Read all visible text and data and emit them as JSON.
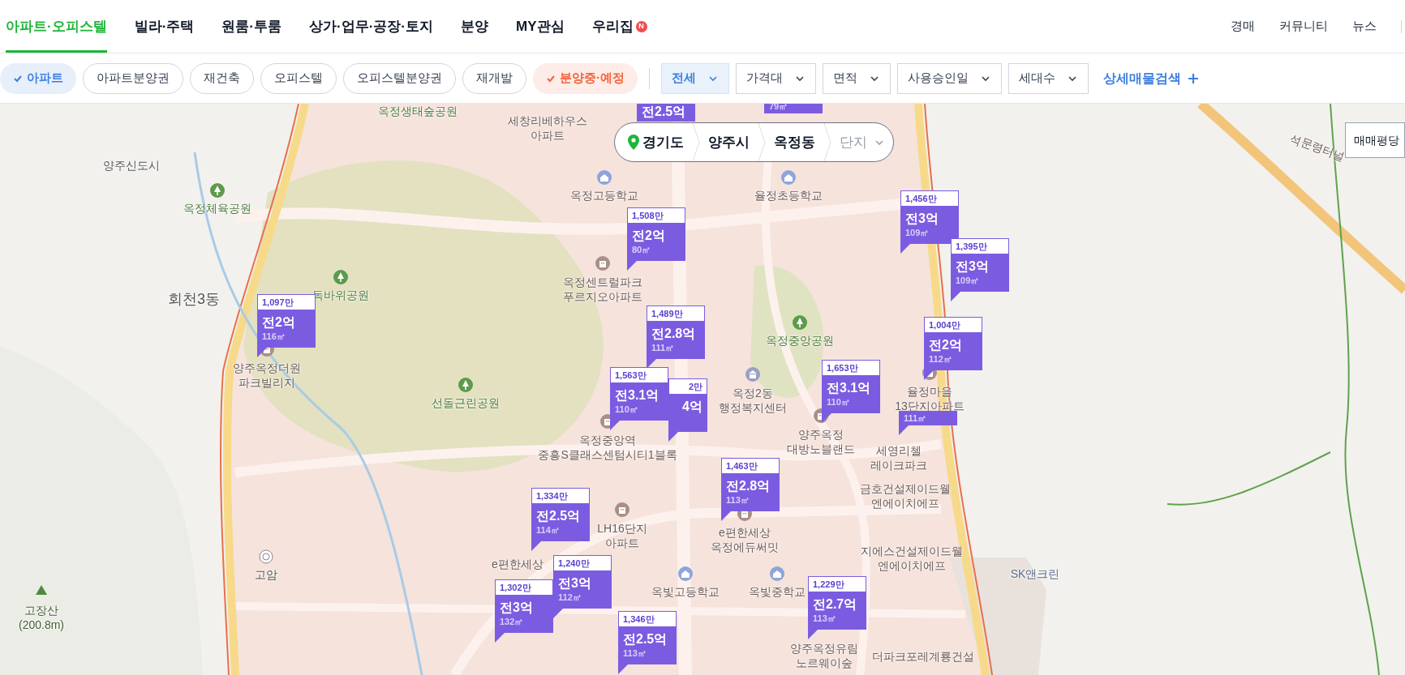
{
  "nav": {
    "tabs": [
      {
        "label": "아파트·오피스텔",
        "selected": true
      },
      {
        "label": "빌라·주택",
        "selected": false
      },
      {
        "label": "원룸·투룸",
        "selected": false
      },
      {
        "label": "상가·업무·공장·토지",
        "selected": false
      },
      {
        "label": "분양",
        "selected": false
      },
      {
        "label": "MY관심",
        "selected": false
      },
      {
        "label": "우리집",
        "selected": false,
        "badge": "N"
      }
    ],
    "links": [
      "경매",
      "커뮤니티",
      "뉴스"
    ]
  },
  "filters": {
    "chips": [
      {
        "label": "아파트",
        "selected": true,
        "color": "#3d7fe0"
      },
      {
        "label": "아파트분양권",
        "selected": false
      },
      {
        "label": "재건축",
        "selected": false
      },
      {
        "label": "오피스텔",
        "selected": false
      },
      {
        "label": "오피스텔분양권",
        "selected": false
      },
      {
        "label": "재개발",
        "selected": false
      },
      {
        "label": "분양중·예정",
        "selected": true,
        "color": "#f0643c"
      }
    ],
    "dropdowns": [
      {
        "label": "전세",
        "selected": true
      },
      {
        "label": "가격대",
        "selected": false
      },
      {
        "label": "면적",
        "selected": false
      },
      {
        "label": "사용승인일",
        "selected": false
      },
      {
        "label": "세대수",
        "selected": false
      }
    ],
    "detail_search": "상세매물검색"
  },
  "breadcrumb": {
    "items": [
      "경기도",
      "양주시",
      "옥정동"
    ],
    "select": "단지"
  },
  "map": {
    "labels": [
      {
        "text": "옥정생태숲공원",
        "kind": "park"
      },
      {
        "text": "세창리베하우스\n아파트",
        "kind": "apartment"
      },
      {
        "text": "양주신도시",
        "kind": "area"
      },
      {
        "text": "옥정체육공원",
        "kind": "park"
      },
      {
        "text": "회천3동",
        "kind": "district"
      },
      {
        "text": "독바위공원",
        "kind": "park"
      },
      {
        "text": "양주옥정더원\n파크빌리지",
        "kind": "apartment"
      },
      {
        "text": "선돌근린공원",
        "kind": "park"
      },
      {
        "text": "옥정고등학교",
        "kind": "school"
      },
      {
        "text": "율정초등학교",
        "kind": "school"
      },
      {
        "text": "옥정센트럴파크\n푸르지오아파트",
        "kind": "apartment"
      },
      {
        "text": "옥정중앙공원",
        "kind": "park"
      },
      {
        "text": "옥정2동\n행정복지센터",
        "kind": "office"
      },
      {
        "text": "양주옥정\n대방노블랜드",
        "kind": "apartment"
      },
      {
        "text": "율정마을\n13단지아파트",
        "kind": "apartment"
      },
      {
        "text": "세영리첼\n레이크파크",
        "kind": "apartment"
      },
      {
        "text": "옥정중앙역\n중흥S클래스센텀시티1블록",
        "kind": "apartment"
      },
      {
        "text": "LH16단지\n아파트",
        "kind": "apartment"
      },
      {
        "text": "e편한세상\n옥정에듀써밋",
        "kind": "apartment"
      },
      {
        "text": "금호건설제이드웰\n엔에이치에프",
        "kind": "apartment"
      },
      {
        "text": "지에스건설제이드웰\n엔에이치에프",
        "kind": "apartment"
      },
      {
        "text": "옥빛고등학교",
        "kind": "school"
      },
      {
        "text": "옥빛중학교",
        "kind": "school"
      },
      {
        "text": "양주옥정유림\n노르웨이숲",
        "kind": "apartment"
      },
      {
        "text": "더파크포레계룡건설",
        "kind": "apartment"
      },
      {
        "text": "SK앤크린",
        "kind": "shop"
      },
      {
        "text": "고암",
        "kind": "interchange"
      },
      {
        "text": "고장산\n(200.8m)",
        "kind": "mountain"
      },
      {
        "text": "e편한세상",
        "kind": "apartment"
      },
      {
        "text": "석문령터널",
        "kind": "tunnel"
      }
    ],
    "markers": [
      {
        "kind": "clipped",
        "label": "전2.5억"
      },
      {
        "kind": "clipped",
        "area": "79㎡"
      },
      {
        "kind": "full",
        "price": "1,097만",
        "label": "전2억",
        "area": "116㎡"
      },
      {
        "kind": "full",
        "price": "1,508만",
        "label": "전2억",
        "area": "80㎡"
      },
      {
        "kind": "full",
        "price": "1,456만",
        "label": "전3억",
        "area": "109㎡"
      },
      {
        "kind": "full",
        "price": "1,395만",
        "label": "전3억",
        "area": "109㎡"
      },
      {
        "kind": "full",
        "price": "1,489만",
        "label": "전2.8억",
        "area": "111㎡"
      },
      {
        "kind": "full",
        "price": "1,004만",
        "label": "전2억",
        "area": "112㎡"
      },
      {
        "kind": "full",
        "price": "1,563만",
        "label": "전3.1억",
        "area": "110㎡"
      },
      {
        "kind": "covered",
        "price": "2만",
        "label": "4억"
      },
      {
        "kind": "full",
        "price": "1,653만",
        "label": "전3.1억",
        "area": "110㎡"
      },
      {
        "kind": "partial",
        "area": "111㎡"
      },
      {
        "kind": "full",
        "price": "1,463만",
        "label": "전2.8억",
        "area": "113㎡"
      },
      {
        "kind": "full",
        "price": "1,334만",
        "label": "전2.5억",
        "area": "114㎡"
      },
      {
        "kind": "full",
        "price": "1,302만",
        "label": "전3억",
        "area": "132㎡"
      },
      {
        "kind": "full",
        "price": "1,240만",
        "label": "전3억",
        "area": "112㎡"
      },
      {
        "kind": "full",
        "price": "1,346만",
        "label": "전2.5억",
        "area": "113㎡"
      },
      {
        "kind": "full",
        "price": "1,229만",
        "label": "전2.7억",
        "area": "113㎡"
      }
    ],
    "view_button": "매매평당"
  }
}
